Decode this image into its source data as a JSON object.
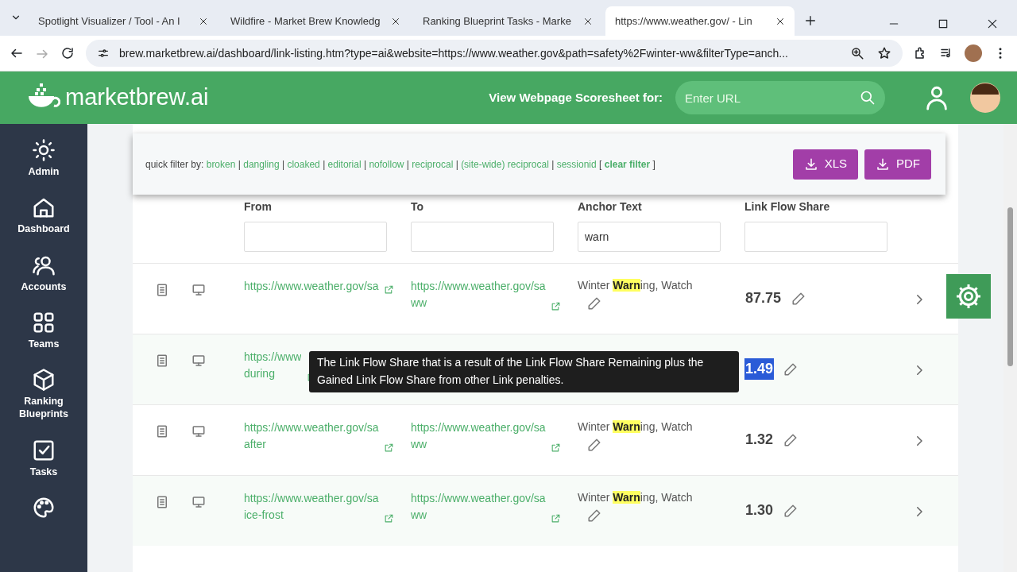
{
  "browser": {
    "tabs": [
      {
        "title": "Spotlight Visualizer / Tool - An I",
        "selected": false
      },
      {
        "title": "Wildfire - Market Brew Knowledg",
        "selected": false
      },
      {
        "title": "Ranking Blueprint Tasks - Marke",
        "selected": false
      },
      {
        "title": "https://www.weather.gov/ - Lin",
        "selected": true
      }
    ],
    "address": "brew.marketbrew.ai/dashboard/link-listing.htm?type=ai&website=https://www.weather.gov&path=safety%2Fwinter-ww&filterType=anch..."
  },
  "header": {
    "logo": "marketbrew.ai",
    "scoresheet_label": "View Webpage Scoresheet for:",
    "search": {
      "placeholder": "Enter URL"
    }
  },
  "sidebar": {
    "items": [
      {
        "kind": "sun",
        "label": "Admin"
      },
      {
        "kind": "house",
        "label": "Dashboard"
      },
      {
        "kind": "people",
        "label": "Accounts"
      },
      {
        "kind": "grid",
        "label": "Teams"
      },
      {
        "kind": "cube",
        "label": "Ranking Blueprints"
      },
      {
        "kind": "check",
        "label": "Tasks"
      },
      {
        "kind": "palette"
      }
    ]
  },
  "quick_filter": {
    "label": "quick filter by:",
    "filters": [
      "broken",
      "dangling",
      "cloaked",
      "editorial",
      "nofollow",
      "reciprocal",
      "(site-wide) reciprocal",
      "sessionid"
    ],
    "separator": "|",
    "open_bracket": "[",
    "clear": "clear filter",
    "close_bracket": "]"
  },
  "export_buttons": [
    "XLS",
    "PDF"
  ],
  "table": {
    "columns": [
      {
        "title": "From"
      },
      {
        "title": "To"
      },
      {
        "title": "Anchor Text",
        "filter": "warn"
      },
      {
        "title": "Link Flow Share"
      }
    ],
    "rows": [
      {
        "from": [
          "https://www.weather.gov/sa"
        ],
        "to": [
          "https://www.weather.gov/sa",
          "ww"
        ],
        "anchor": "Winter **Warn**ing, Watch",
        "share": "87.75",
        "selected": false
      },
      {
        "from": [
          "https://www",
          "during"
        ],
        "share": "1.49",
        "selected": true
      },
      {
        "from": [
          "https://www.weather.gov/sa",
          "after"
        ],
        "to": [
          "https://www.weather.gov/sa",
          "ww"
        ],
        "anchor": "Winter **Warn**ing, Watch",
        "share": "1.32",
        "selected": false
      },
      {
        "from": [
          "https://www.weather.gov/sa",
          "ice-frost"
        ],
        "to": [
          "https://www.weather.gov/sa",
          "ww"
        ],
        "anchor": "Winter **Warn**ing, Watch",
        "share": "1.30",
        "selected": false
      }
    ]
  },
  "tooltip": "The Link Flow Share that is a result of the Link Flow Share Remaining plus the Gained Link Flow Share from other Link penalties."
}
